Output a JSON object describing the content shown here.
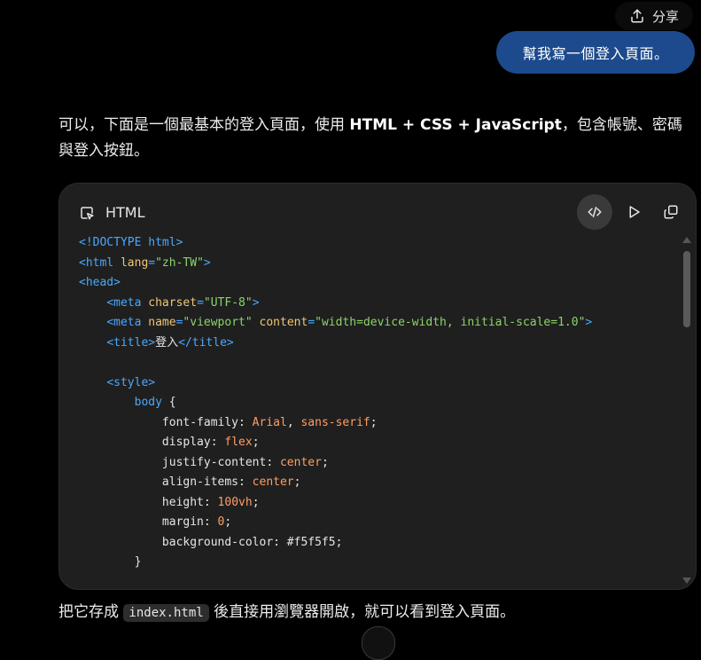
{
  "header": {
    "share_label": "分享"
  },
  "user_message": "幫我寫一個登入頁面。",
  "assistant": {
    "intro_pre": "可以，下面是一個最基本的登入頁面，使用 ",
    "intro_bold": "HTML + CSS + JavaScript",
    "intro_post": "，包含帳號、密碼與登入按鈕。",
    "outro_pre": "把它存成 ",
    "outro_code": "index.html",
    "outro_post": " 後直接用瀏覽器開啟，就可以看到登入頁面。"
  },
  "code_block": {
    "language": "HTML",
    "icons": {
      "code_view": "code-icon",
      "run": "play-icon",
      "copy": "copy-icon"
    },
    "lines": [
      [
        {
          "t": "tag",
          "v": "<!DOCTYPE html>"
        }
      ],
      [
        {
          "t": "tag",
          "v": "<html "
        },
        {
          "t": "attr",
          "v": "lang"
        },
        {
          "t": "tag",
          "v": "="
        },
        {
          "t": "str",
          "v": "\"zh-TW\""
        },
        {
          "t": "tag",
          "v": ">"
        }
      ],
      [
        {
          "t": "tag",
          "v": "<head>"
        }
      ],
      [
        {
          "t": "plain",
          "v": "    "
        },
        {
          "t": "tag",
          "v": "<meta "
        },
        {
          "t": "attr",
          "v": "charset"
        },
        {
          "t": "tag",
          "v": "="
        },
        {
          "t": "str",
          "v": "\"UTF-8\""
        },
        {
          "t": "tag",
          "v": ">"
        }
      ],
      [
        {
          "t": "plain",
          "v": "    "
        },
        {
          "t": "tag",
          "v": "<meta "
        },
        {
          "t": "attr",
          "v": "name"
        },
        {
          "t": "tag",
          "v": "="
        },
        {
          "t": "str",
          "v": "\"viewport\""
        },
        {
          "t": "plain",
          "v": " "
        },
        {
          "t": "attr",
          "v": "content"
        },
        {
          "t": "tag",
          "v": "="
        },
        {
          "t": "str",
          "v": "\"width=device-width, initial-scale=1.0\""
        },
        {
          "t": "tag",
          "v": ">"
        }
      ],
      [
        {
          "t": "plain",
          "v": "    "
        },
        {
          "t": "tag",
          "v": "<title>"
        },
        {
          "t": "plain",
          "v": "登入"
        },
        {
          "t": "tag",
          "v": "</title>"
        }
      ],
      [
        {
          "t": "plain",
          "v": ""
        }
      ],
      [
        {
          "t": "plain",
          "v": "    "
        },
        {
          "t": "tag",
          "v": "<style>"
        }
      ],
      [
        {
          "t": "plain",
          "v": "        "
        },
        {
          "t": "tag",
          "v": "body"
        },
        {
          "t": "plain",
          "v": " {"
        }
      ],
      [
        {
          "t": "plain",
          "v": "            font-family: "
        },
        {
          "t": "val",
          "v": "Arial"
        },
        {
          "t": "plain",
          "v": ", "
        },
        {
          "t": "val",
          "v": "sans-serif"
        },
        {
          "t": "plain",
          "v": ";"
        }
      ],
      [
        {
          "t": "plain",
          "v": "            display: "
        },
        {
          "t": "val",
          "v": "flex"
        },
        {
          "t": "plain",
          "v": ";"
        }
      ],
      [
        {
          "t": "plain",
          "v": "            justify-content: "
        },
        {
          "t": "val",
          "v": "center"
        },
        {
          "t": "plain",
          "v": ";"
        }
      ],
      [
        {
          "t": "plain",
          "v": "            align-items: "
        },
        {
          "t": "val",
          "v": "center"
        },
        {
          "t": "plain",
          "v": ";"
        }
      ],
      [
        {
          "t": "plain",
          "v": "            height: "
        },
        {
          "t": "val",
          "v": "100vh"
        },
        {
          "t": "plain",
          "v": ";"
        }
      ],
      [
        {
          "t": "plain",
          "v": "            margin: "
        },
        {
          "t": "val",
          "v": "0"
        },
        {
          "t": "plain",
          "v": ";"
        }
      ],
      [
        {
          "t": "plain",
          "v": "            background-color: #f5f5f5;"
        }
      ],
      [
        {
          "t": "plain",
          "v": "        }"
        }
      ]
    ]
  },
  "colors": {
    "user_bubble": "#1d4a8d",
    "code_bg": "#1f1f1f",
    "tag": "#4aa8ff",
    "attr": "#f0c674",
    "string": "#8bd46a",
    "value": "#ff9e64"
  }
}
